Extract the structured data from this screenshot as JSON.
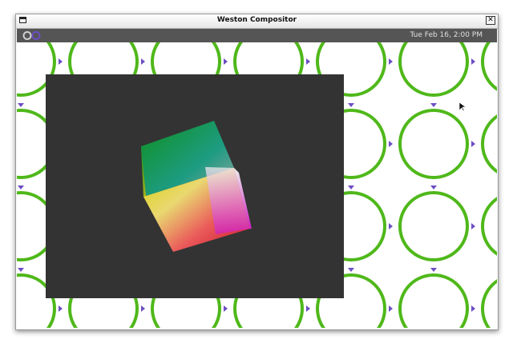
{
  "window": {
    "title": "Weston Compositor",
    "close_label": "✕"
  },
  "panel": {
    "clock": "Tue Feb 16, 2:00 PM"
  },
  "colors": {
    "ring": "#4fb81a",
    "arrow": "#6c4ec4",
    "panel": "#555555",
    "app_bg": "#333333"
  },
  "icons": [
    "window-menu-icon",
    "close-icon",
    "launcher-icon",
    "cursor-icon"
  ]
}
